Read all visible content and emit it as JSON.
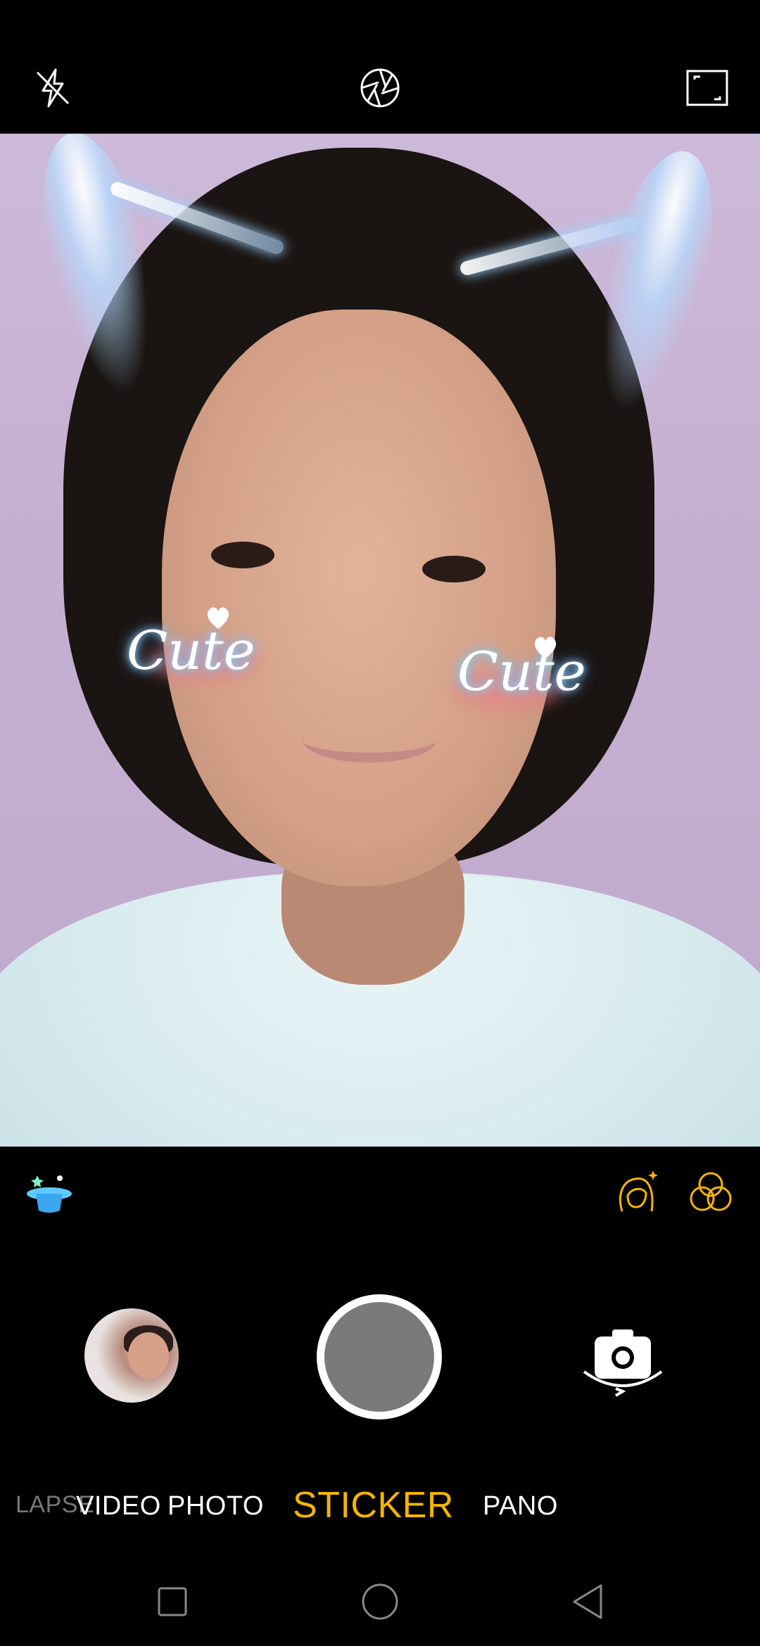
{
  "top_bar": {
    "flash_icon": "flash-off-icon",
    "aperture_icon": "aperture-icon",
    "aspect_icon": "aspect-ratio-icon"
  },
  "viewfinder": {
    "sticker_left_text": "Cute",
    "sticker_right_text": "Cute"
  },
  "tools": {
    "magic_icon": "magic-hat-icon",
    "beauty_icon": "beauty-face-icon",
    "filter_icon": "filter-circles-icon"
  },
  "modes": [
    {
      "label": "LAPSE",
      "state": "faded"
    },
    {
      "label": "VIDEO",
      "state": "normal"
    },
    {
      "label": "PHOTO",
      "state": "normal"
    },
    {
      "label": "STICKER",
      "state": "active"
    },
    {
      "label": "PANO",
      "state": "normal"
    }
  ],
  "colors": {
    "accent": "#F5B500",
    "background": "#000000",
    "shutter_inner": "#7A7A7A"
  }
}
